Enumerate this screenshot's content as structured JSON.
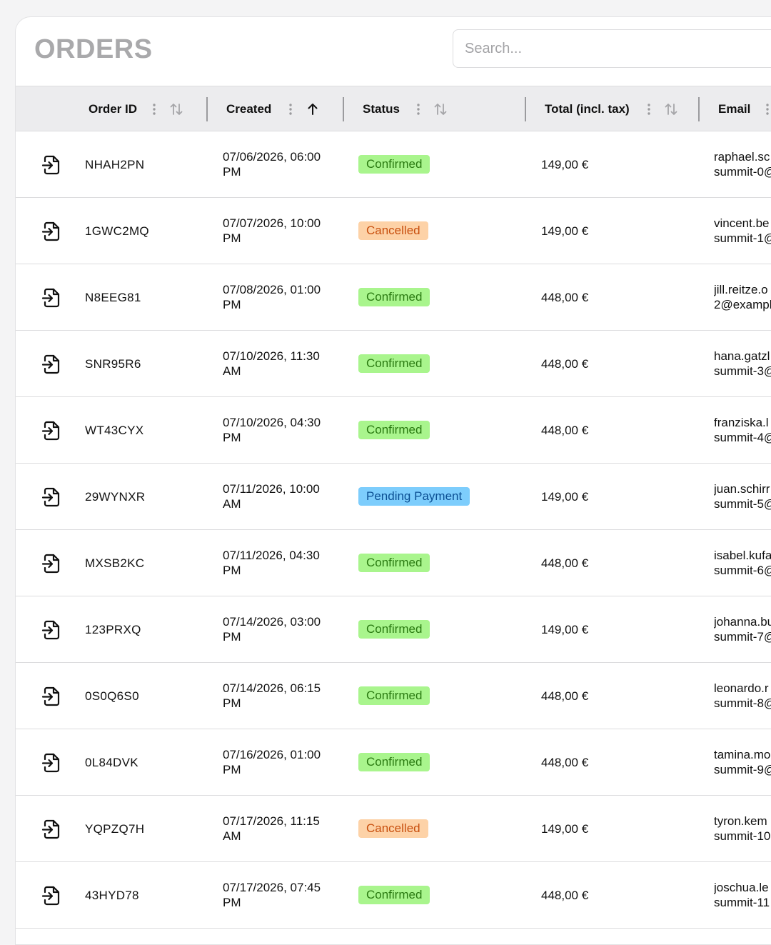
{
  "page": {
    "title": "ORDERS"
  },
  "search": {
    "placeholder": "Search..."
  },
  "columns": {
    "order_id": "Order ID",
    "created": "Created",
    "status": "Status",
    "total": "Total (incl. tax)",
    "email": "Email"
  },
  "sort": {
    "created": "ascending"
  },
  "colors": {
    "confirmed_bg": "#a9f58d",
    "cancelled_bg": "#fdd2a7",
    "pending_bg": "#7dcdfc"
  },
  "icons": {
    "row_action": "file-import-icon",
    "column_menu": "more-vertical-icon",
    "sort": "sort-arrows-icon",
    "sort_asc": "arrow-up-icon"
  },
  "rows": [
    {
      "id": "NHAH2PN",
      "created_line1": "07/06/2026, 06:00",
      "created_line2": "PM",
      "status": "Confirmed",
      "total": "149,00 €",
      "email_line1": "raphael.sc",
      "email_line2": "summit-0@"
    },
    {
      "id": "1GWC2MQ",
      "created_line1": "07/07/2026, 10:00",
      "created_line2": "PM",
      "status": "Cancelled",
      "total": "149,00 €",
      "email_line1": "vincent.be",
      "email_line2": "summit-1@"
    },
    {
      "id": "N8EEG81",
      "created_line1": "07/08/2026, 01:00",
      "created_line2": "PM",
      "status": "Confirmed",
      "total": "448,00 €",
      "email_line1": "jill.reitze.o",
      "email_line2": "2@exampl"
    },
    {
      "id": "SNR95R6",
      "created_line1": "07/10/2026, 11:30",
      "created_line2": "AM",
      "status": "Confirmed",
      "total": "448,00 €",
      "email_line1": "hana.gatzl",
      "email_line2": "summit-3@"
    },
    {
      "id": "WT43CYX",
      "created_line1": "07/10/2026, 04:30",
      "created_line2": "PM",
      "status": "Confirmed",
      "total": "448,00 €",
      "email_line1": "franziska.l",
      "email_line2": "summit-4@"
    },
    {
      "id": "29WYNXR",
      "created_line1": "07/11/2026, 10:00",
      "created_line2": "AM",
      "status": "Pending Payment",
      "total": "149,00 €",
      "email_line1": "juan.schirr",
      "email_line2": "summit-5@"
    },
    {
      "id": "MXSB2KC",
      "created_line1": "07/11/2026, 04:30",
      "created_line2": "PM",
      "status": "Confirmed",
      "total": "448,00 €",
      "email_line1": "isabel.kufa",
      "email_line2": "summit-6@"
    },
    {
      "id": "123PRXQ",
      "created_line1": "07/14/2026, 03:00",
      "created_line2": "PM",
      "status": "Confirmed",
      "total": "149,00 €",
      "email_line1": "johanna.bu",
      "email_line2": "summit-7@"
    },
    {
      "id": "0S0Q6S0",
      "created_line1": "07/14/2026, 06:15",
      "created_line2": "PM",
      "status": "Confirmed",
      "total": "448,00 €",
      "email_line1": "leonardo.r",
      "email_line2": "summit-8@"
    },
    {
      "id": "0L84DVK",
      "created_line1": "07/16/2026, 01:00",
      "created_line2": "PM",
      "status": "Confirmed",
      "total": "448,00 €",
      "email_line1": "tamina.mo",
      "email_line2": "summit-9@"
    },
    {
      "id": "YQPZQ7H",
      "created_line1": "07/17/2026, 11:15",
      "created_line2": "AM",
      "status": "Cancelled",
      "total": "149,00 €",
      "email_line1": "tyron.kem",
      "email_line2": "summit-10"
    },
    {
      "id": "43HYD78",
      "created_line1": "07/17/2026, 07:45",
      "created_line2": "PM",
      "status": "Confirmed",
      "total": "448,00 €",
      "email_line1": "joschua.le",
      "email_line2": "summit-11"
    }
  ]
}
